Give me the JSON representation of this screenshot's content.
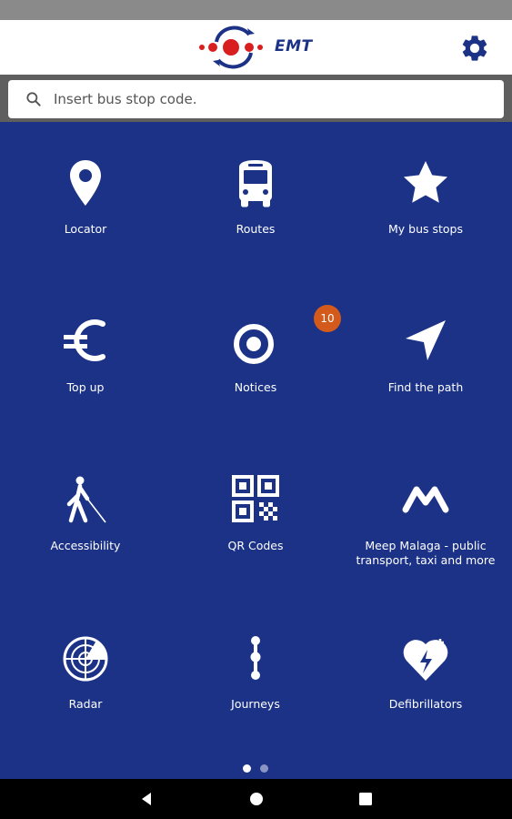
{
  "app": {
    "logo_text": "EMT",
    "logo_icon": "emt-logo",
    "settings_icon": "gear-icon"
  },
  "search": {
    "placeholder": "Insert bus stop code.",
    "value": "",
    "icon": "search-icon"
  },
  "menu": [
    {
      "label": "Locator",
      "icon": "location-pin-icon"
    },
    {
      "label": "Routes",
      "icon": "bus-icon"
    },
    {
      "label": "My bus stops",
      "icon": "star-icon"
    },
    {
      "label": "Top up",
      "icon": "euro-icon"
    },
    {
      "label": "Notices",
      "icon": "notices-icon",
      "badge": "10"
    },
    {
      "label": "Find the path",
      "icon": "navigation-arrow-icon"
    },
    {
      "label": "Accessibility",
      "icon": "blind-person-icon"
    },
    {
      "label": "QR Codes",
      "icon": "qr-code-icon"
    },
    {
      "label": "Meep Malaga - public transport, taxi and more",
      "icon": "meep-logo-icon"
    },
    {
      "label": "Radar",
      "icon": "radar-icon"
    },
    {
      "label": "Journeys",
      "icon": "journeys-icon"
    },
    {
      "label": "Defibrillators",
      "icon": "defibrillator-icon"
    }
  ],
  "pager": {
    "total": 2,
    "active": 1
  },
  "nav": {
    "back": "back-icon",
    "home": "home-icon",
    "recents": "recents-icon"
  },
  "colors": {
    "background": "#1b3287",
    "status_bar": "#8a8a8a",
    "search_strip": "#5f5f5f",
    "badge": "#d35a1a",
    "logo_red": "#d81e1e",
    "logo_blue": "#1b3287"
  }
}
